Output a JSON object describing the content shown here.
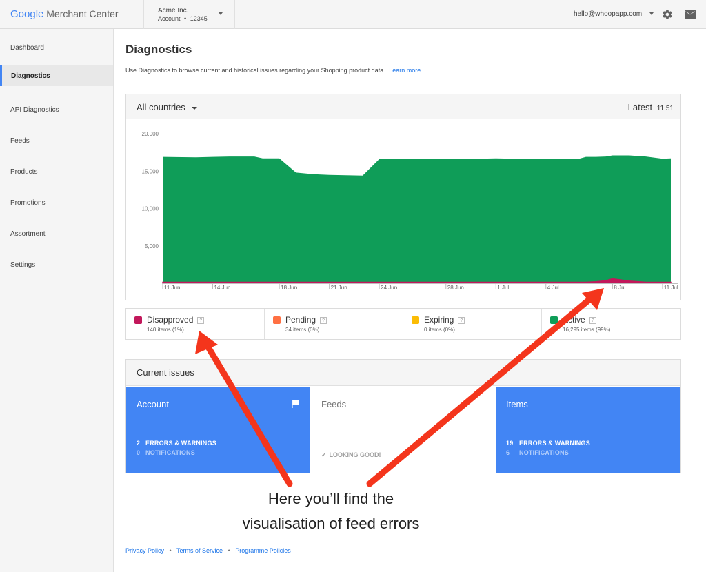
{
  "header": {
    "brand_google": "Google",
    "brand_product": "Merchant Center",
    "account_name": "Acme Inc.",
    "account_prefix": "Account",
    "account_sep": "•",
    "account_id": "12345",
    "user_email": "hello@whoopapp.com",
    "icons": [
      "gear-icon",
      "mail-icon"
    ]
  },
  "sidebar": {
    "items": [
      {
        "label": "Dashboard",
        "active": false
      },
      {
        "label": "Diagnostics",
        "active": true
      },
      {
        "label": "API Diagnostics",
        "active": false
      },
      {
        "label": "Feeds",
        "active": false
      },
      {
        "label": "Products",
        "active": false
      },
      {
        "label": "Promotions",
        "active": false
      },
      {
        "label": "Assortment",
        "active": false
      },
      {
        "label": "Settings",
        "active": false
      }
    ]
  },
  "main": {
    "title": "Diagnostics",
    "description": "Use Diagnostics to browse current and historical issues regarding your Shopping product data.",
    "learn_more": "Learn more",
    "country_filter": "All countries",
    "latest_label": "Latest",
    "latest_time": "11:51"
  },
  "chart_data": {
    "type": "area",
    "title": "",
    "xlabel": "",
    "ylabel": "",
    "ylim": [
      0,
      20000
    ],
    "y_ticks": [
      5000,
      10000,
      15000,
      20000
    ],
    "y_tick_labels": [
      "5,000",
      "10,000",
      "15,000",
      "20,000"
    ],
    "x_tick_labels": [
      "11 Jun",
      "14 Jun",
      "18 Jun",
      "21 Jun",
      "24 Jun",
      "28 Jun",
      "1 Jul",
      "4 Jul",
      "8 Jul",
      "11 Jul"
    ],
    "x_tick_days": [
      0,
      3,
      7,
      10,
      13,
      17,
      20,
      23,
      27,
      30
    ],
    "x": [
      0,
      2,
      3,
      4,
      5.5,
      6,
      7,
      8,
      9,
      9.4,
      10,
      11,
      12,
      13,
      14,
      15,
      16,
      17,
      18,
      19,
      20,
      21,
      22,
      23,
      24,
      25,
      25.4,
      26,
      26.6,
      27,
      28,
      29,
      30,
      30.5
    ],
    "series": [
      {
        "name": "Active",
        "color": "#0f9d58",
        "values": [
          16900,
          16850,
          16900,
          16950,
          16950,
          16700,
          16700,
          14800,
          14600,
          14550,
          14500,
          14450,
          14400,
          16600,
          16600,
          16650,
          16650,
          16650,
          16650,
          16650,
          16700,
          16650,
          16650,
          16650,
          16650,
          16650,
          16900,
          16900,
          16950,
          17100,
          17100,
          16950,
          16650,
          16700
        ]
      },
      {
        "name": "Disapproved",
        "color": "#c2185b",
        "values": [
          140,
          140,
          140,
          140,
          140,
          140,
          140,
          140,
          140,
          140,
          140,
          140,
          140,
          140,
          140,
          140,
          140,
          140,
          140,
          140,
          140,
          140,
          140,
          140,
          140,
          140,
          140,
          200,
          350,
          600,
          300,
          140,
          140,
          140
        ]
      }
    ]
  },
  "legend": [
    {
      "label": "Disapproved",
      "count": "140 items (1%)",
      "color": "#c2185b"
    },
    {
      "label": "Pending",
      "count": "34 items (0%)",
      "color": "#ff7043"
    },
    {
      "label": "Expiring",
      "count": "0 items (0%)",
      "color": "#fbbc05"
    },
    {
      "label": "Active",
      "count": "16,295 items (99%)",
      "color": "#0f9d58"
    }
  ],
  "legend_help": "?",
  "issues": {
    "title": "Current issues",
    "account": {
      "title": "Account",
      "errors_count": "2",
      "errors_label": "ERRORS & WARNINGS",
      "notif_count": "0",
      "notif_label": "NOTIFICATIONS"
    },
    "feeds": {
      "title": "Feeds",
      "status": "LOOKING GOOD!"
    },
    "items": {
      "title": "Items",
      "errors_count": "19",
      "errors_label": "ERRORS & WARNINGS",
      "notif_count": "6",
      "notif_label": "NOTIFICATIONS"
    }
  },
  "annotation": {
    "line1": "Here you’ll find the",
    "line2": "visualisation of feed errors",
    "arrow_color": "#f4351c"
  },
  "footer": {
    "links": [
      "Privacy Policy",
      "Terms of Service",
      "Programme Policies"
    ],
    "sep": "•"
  }
}
